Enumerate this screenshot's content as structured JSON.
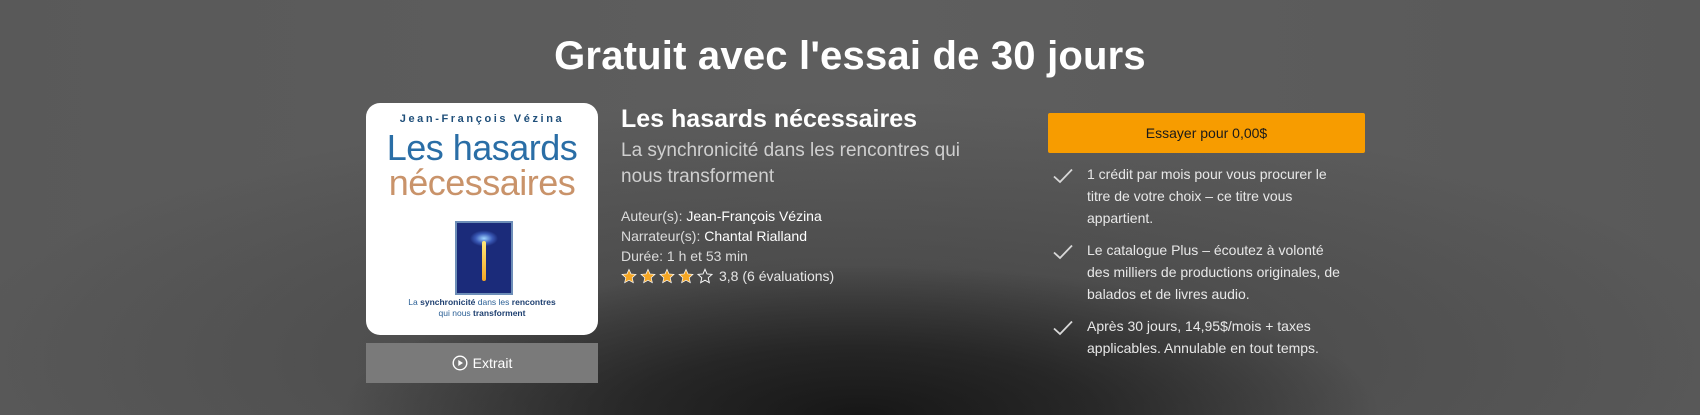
{
  "headline": "Gratuit avec l'essai de 30 jours",
  "cover": {
    "author": "Jean-François Vézina",
    "title_line1": "Les hasards",
    "title_line2": "nécessaires",
    "subtitle_p1": "La ",
    "subtitle_b1": "synchronicité",
    "subtitle_p2": " dans les ",
    "subtitle_b2": "rencontres",
    "subtitle_p3": "qui nous ",
    "subtitle_b3": "transforment"
  },
  "extrait_label": "Extrait",
  "book": {
    "title": "Les hasards nécessaires",
    "subtitle": "La synchronicité dans les rencontres qui nous transforment",
    "author_label": "Auteur(s):",
    "author": "Jean-François Vézina",
    "narrator_label": "Narrateur(s):",
    "narrator": "Chantal Rialland",
    "duration": "Durée: 1 h et 53 min",
    "rating_value": 3.8,
    "rating_text": "3,8 (6 évaluations)"
  },
  "cta": {
    "label": "Essayer pour 0,00$"
  },
  "benefits": [
    "1 crédit par mois pour vous procurer le titre de votre choix – ce titre vous appartient.",
    "Le catalogue Plus – écoutez à volonté des milliers de productions originales, de balados et de livres audio.",
    "Après 30 jours, 14,95$/mois + taxes applicables. Annulable en tout temps."
  ],
  "colors": {
    "accent": "#f79c00",
    "star": "#f5a623"
  }
}
